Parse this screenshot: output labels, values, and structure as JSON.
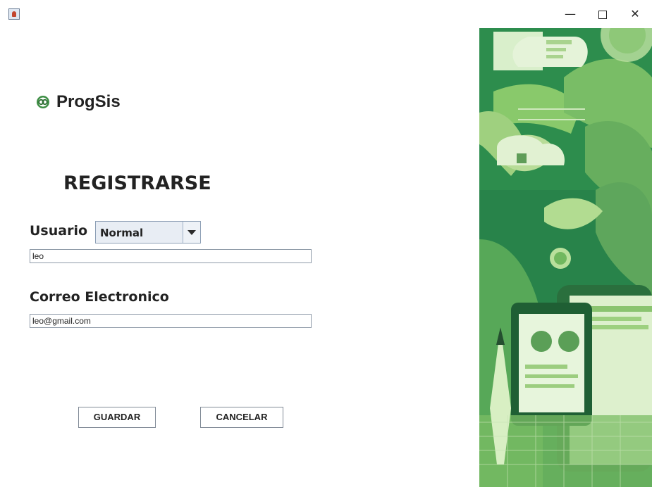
{
  "window": {
    "minimize": "—",
    "close": "✕"
  },
  "brand": {
    "name": "ProgSis"
  },
  "form": {
    "title": "REGISTRARSE",
    "user_label": "Usuario",
    "user_type": "Normal",
    "user_value": "leo",
    "email_label": "Correo Electronico",
    "email_value": "leo@gmail.com",
    "save_label": "GUARDAR",
    "cancel_label": "CANCELAR"
  },
  "colors": {
    "accent_green": "#2e8f4e",
    "dark_green": "#1f6a38",
    "light_green": "#cfe8bd"
  }
}
